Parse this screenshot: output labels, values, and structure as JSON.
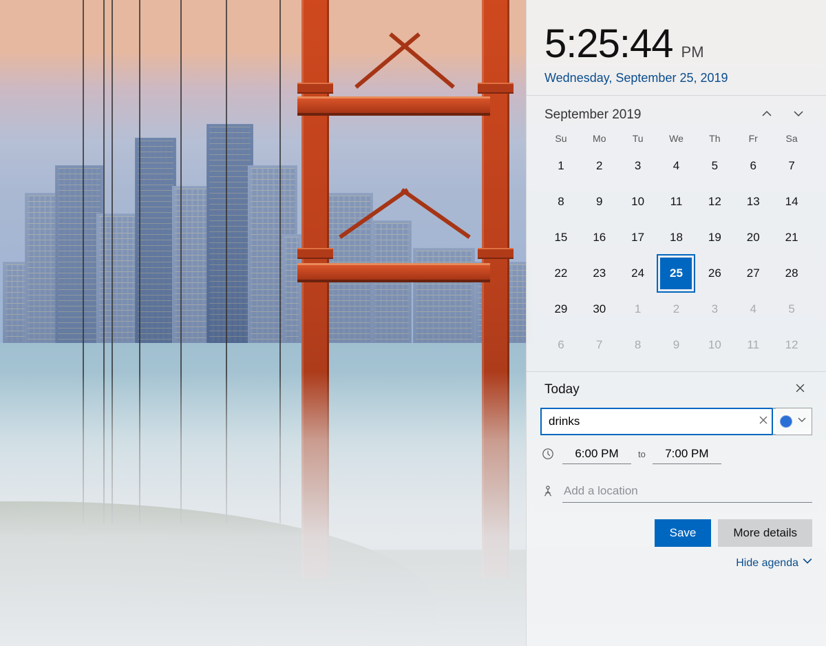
{
  "clock": {
    "time": "5:25:44",
    "ampm": "PM",
    "full_date": "Wednesday, September 25, 2019"
  },
  "calendar": {
    "month_label": "September 2019",
    "days_of_week": [
      "Su",
      "Mo",
      "Tu",
      "We",
      "Th",
      "Fr",
      "Sa"
    ],
    "weeks": [
      [
        {
          "n": "1"
        },
        {
          "n": "2"
        },
        {
          "n": "3"
        },
        {
          "n": "4"
        },
        {
          "n": "5"
        },
        {
          "n": "6"
        },
        {
          "n": "7"
        }
      ],
      [
        {
          "n": "8"
        },
        {
          "n": "9"
        },
        {
          "n": "10"
        },
        {
          "n": "11"
        },
        {
          "n": "12"
        },
        {
          "n": "13"
        },
        {
          "n": "14"
        }
      ],
      [
        {
          "n": "15"
        },
        {
          "n": "16"
        },
        {
          "n": "17"
        },
        {
          "n": "18"
        },
        {
          "n": "19"
        },
        {
          "n": "20"
        },
        {
          "n": "21"
        }
      ],
      [
        {
          "n": "22"
        },
        {
          "n": "23"
        },
        {
          "n": "24"
        },
        {
          "n": "25",
          "today": true
        },
        {
          "n": "26"
        },
        {
          "n": "27"
        },
        {
          "n": "28"
        }
      ],
      [
        {
          "n": "29"
        },
        {
          "n": "30"
        },
        {
          "n": "1",
          "dim": true
        },
        {
          "n": "2",
          "dim": true
        },
        {
          "n": "3",
          "dim": true
        },
        {
          "n": "4",
          "dim": true
        },
        {
          "n": "5",
          "dim": true
        }
      ],
      [
        {
          "n": "6",
          "dim": true
        },
        {
          "n": "7",
          "dim": true
        },
        {
          "n": "8",
          "dim": true
        },
        {
          "n": "9",
          "dim": true
        },
        {
          "n": "10",
          "dim": true
        },
        {
          "n": "11",
          "dim": true
        },
        {
          "n": "12",
          "dim": true
        }
      ]
    ]
  },
  "event": {
    "section_label": "Today",
    "title_value": "drinks",
    "calendar_color": "#2a6fd6",
    "start_time": "6:00 PM",
    "to_label": "to",
    "end_time": "7:00 PM",
    "location_placeholder": "Add a location",
    "save_label": "Save",
    "more_details_label": "More details",
    "hide_agenda_label": "Hide agenda"
  }
}
